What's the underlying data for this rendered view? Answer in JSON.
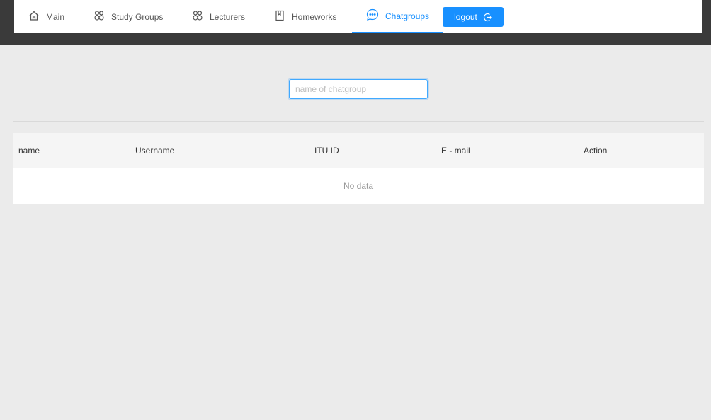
{
  "nav": {
    "items": [
      {
        "label": "Main",
        "icon": "home-icon"
      },
      {
        "label": "Study Groups",
        "icon": "team-icon"
      },
      {
        "label": "Lecturers",
        "icon": "team-icon"
      },
      {
        "label": "Homeworks",
        "icon": "book-icon"
      },
      {
        "label": "Chatgroups",
        "icon": "message-icon",
        "active": true
      }
    ],
    "logout_label": "logout",
    "accent_color": "#1890ff"
  },
  "search": {
    "placeholder": "name of chatgroup",
    "value": ""
  },
  "table": {
    "columns": [
      "name",
      "Username",
      "ITU ID",
      "E - mail",
      "Action"
    ],
    "rows": [],
    "empty_text": "No data"
  }
}
